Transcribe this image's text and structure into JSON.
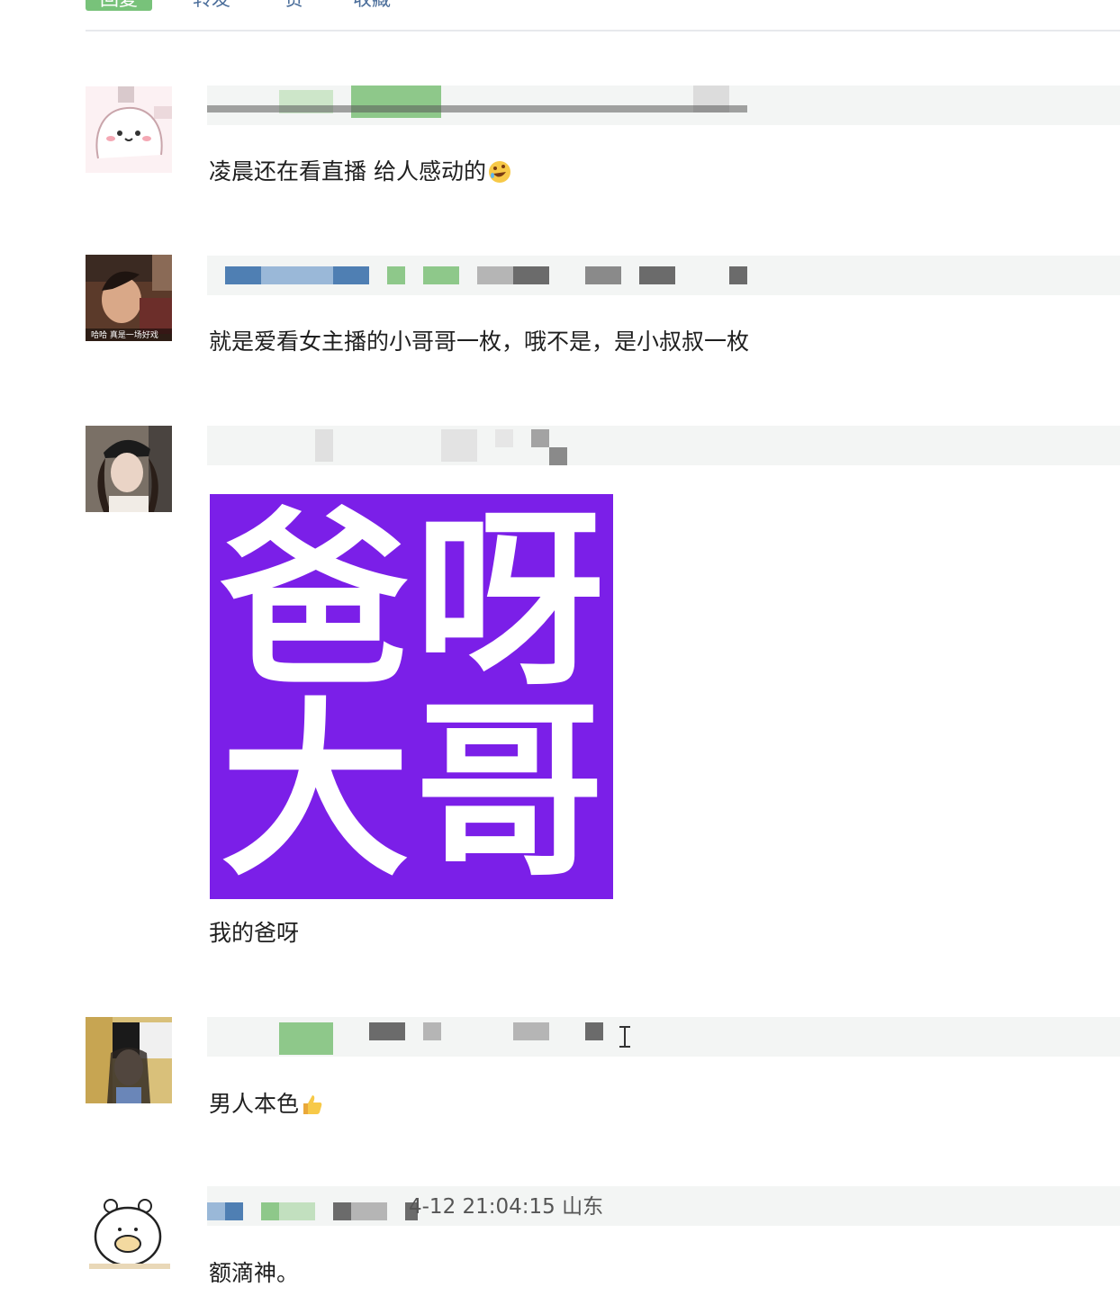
{
  "tabs": {
    "items": [
      {
        "label": "回复",
        "active": true
      },
      {
        "label": "转发",
        "active": false
      },
      {
        "label": "赞",
        "active": false
      },
      {
        "label": "收藏",
        "active": false
      }
    ]
  },
  "comments": [
    {
      "avatar": "cartoon-bunny-avatar",
      "meta_visible_text": "",
      "text": "凌晨还在看直播 给人感动的",
      "emoji": "rofl-emoji"
    },
    {
      "avatar": "photo-avatar-woman-laughing",
      "avatar_caption": "哈哈 真是一场好戏",
      "meta_visible_text": "",
      "text": "就是爱看女主播的小哥哥一枚，哦不是，是小叔叔一枚",
      "emoji": ""
    },
    {
      "avatar": "photo-avatar-woman-cap",
      "meta_visible_text": "",
      "sticker": {
        "chars": [
          "爸",
          "呀",
          "大",
          "哥"
        ],
        "bg": "#7b1fe8"
      },
      "text": "我的爸呀",
      "emoji": ""
    },
    {
      "avatar": "photo-avatar-woman-phone",
      "meta_visible_text": "",
      "text": "男人本色",
      "emoji": "thumbs-up-emoji"
    },
    {
      "avatar": "cartoon-bear-avatar",
      "meta_visible_text": "4-12 21:04:15 山东",
      "text": "额滴神。",
      "emoji": ""
    }
  ],
  "colors": {
    "tab_active": "#78c27a",
    "link_blue": "#4a6d9a",
    "sticker_purple": "#7b1fe8",
    "meta_bg": "#f3f5f4"
  }
}
